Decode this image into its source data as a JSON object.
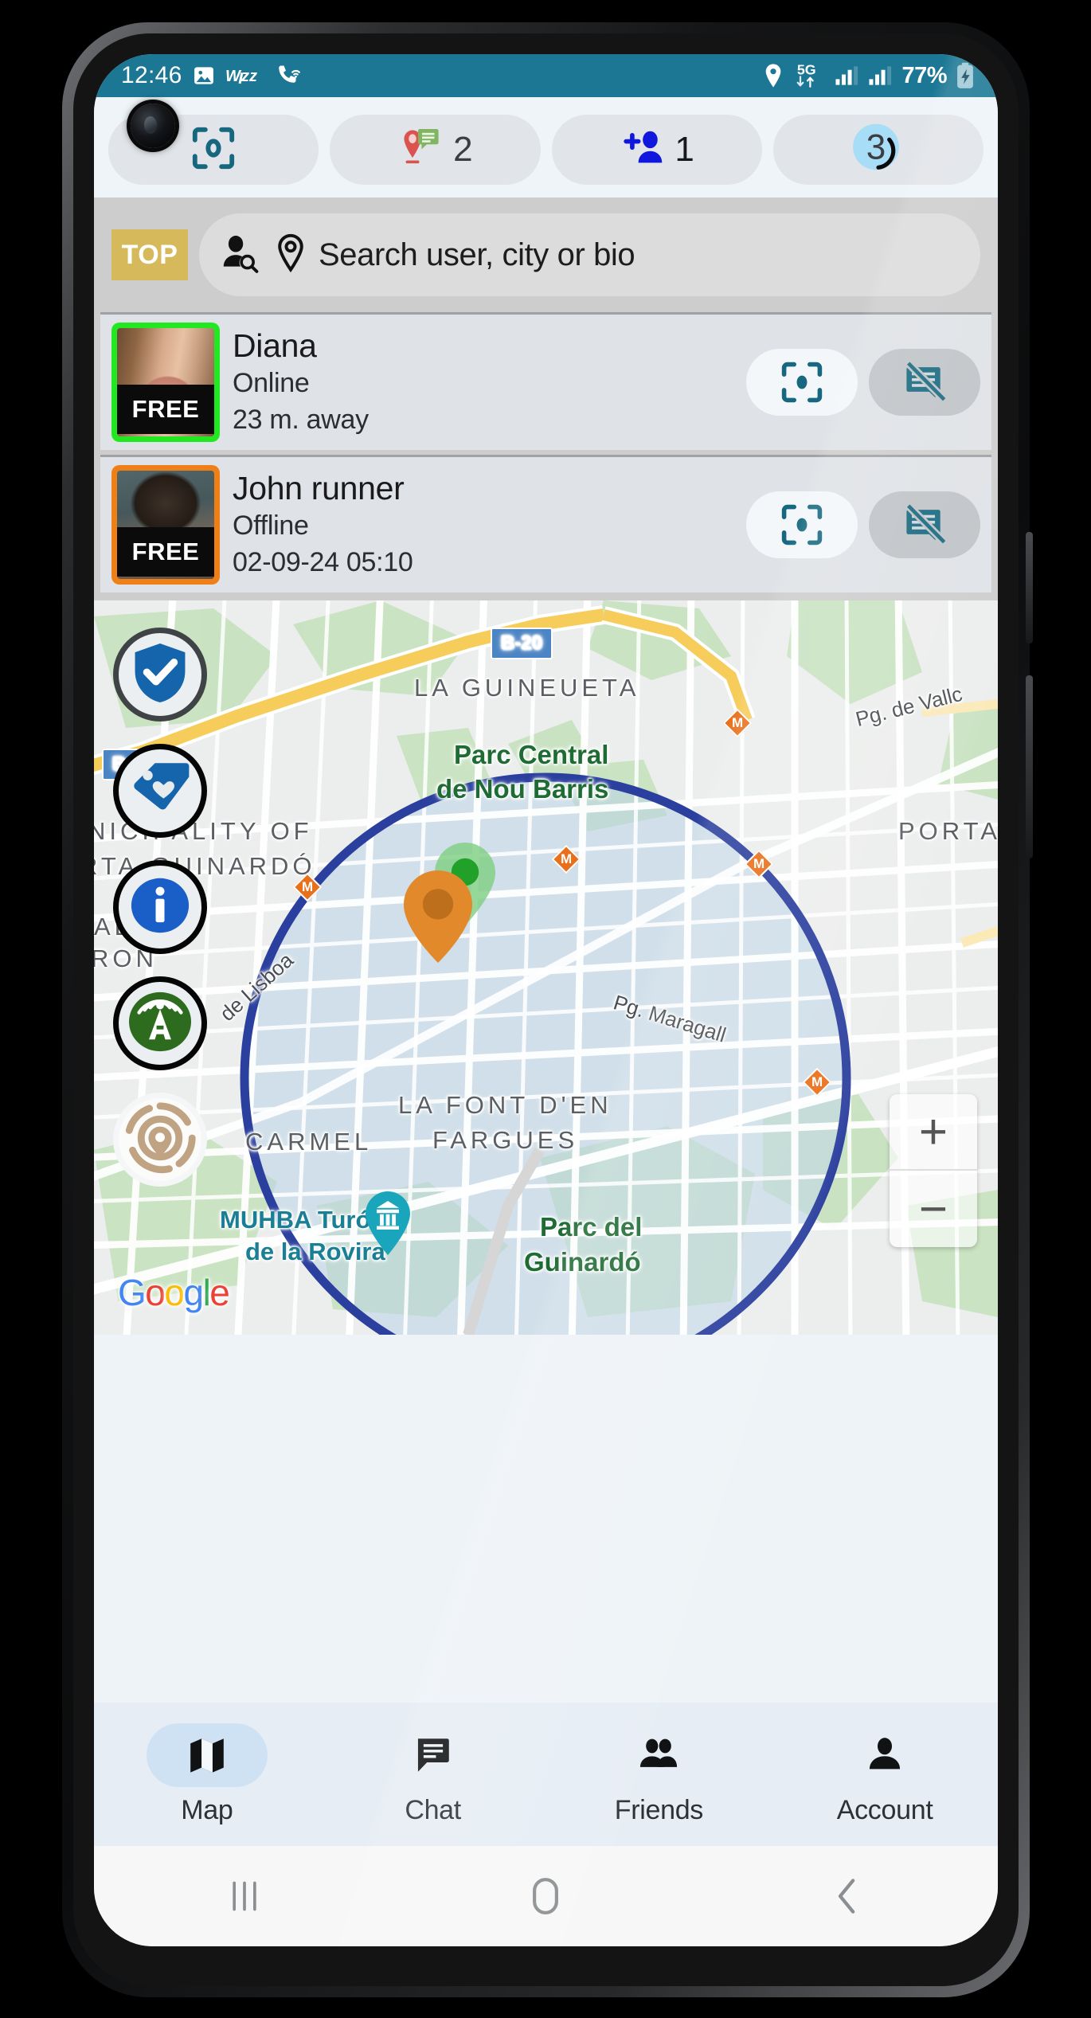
{
  "status_bar": {
    "time": "12:46",
    "battery_percent": "77%",
    "network_type": "5G",
    "left_icons": [
      "image-icon",
      "wizz-icon",
      "call-wifi-icon"
    ],
    "right_icons": [
      "location-pin-icon",
      "5g-data-icon",
      "signal-bars-1-icon",
      "signal-bars-2-icon",
      "battery-charging-icon"
    ],
    "background_color": "#1b7794"
  },
  "chips": [
    {
      "name": "focus-scan-chip",
      "icon": "focus-scan-icon",
      "count": ""
    },
    {
      "name": "messages-chip",
      "icon": "pin-message-icon",
      "count": "2"
    },
    {
      "name": "friend-requests-chip",
      "icon": "add-person-icon",
      "count": "1"
    },
    {
      "name": "pending-chip",
      "icon": "circle-count-icon",
      "count": "3"
    }
  ],
  "search": {
    "badge": "TOP",
    "placeholder": "Search user, city or bio",
    "badge_color": "#d5b95a"
  },
  "users": [
    {
      "name": "Diana",
      "status": "Online",
      "sub": "23 m. away",
      "badge": "FREE",
      "border_color": "#22e822",
      "actions": [
        "locate-button",
        "chat-disabled-button"
      ]
    },
    {
      "name": "John runner",
      "status": "Offline",
      "sub": "02-09-24 05:10",
      "badge": "FREE",
      "border_color": "#ef8018",
      "actions": [
        "locate-button",
        "chat-disabled-button"
      ]
    }
  ],
  "map_fabs": [
    {
      "name": "verified-shield-fab",
      "icon": "shield-check-icon",
      "color": "#1565ad"
    },
    {
      "name": "favorites-fab",
      "icon": "tag-heart-icon",
      "color": "#1565ad"
    },
    {
      "name": "info-fab",
      "icon": "info-icon",
      "color": "#1a5fc8"
    },
    {
      "name": "broadcast-fab",
      "icon": "antenna-broadcast-icon",
      "color": "#2d6b1f"
    },
    {
      "name": "radar-locate-fab",
      "icon": "radar-target-icon",
      "color": "#c0a383"
    }
  ],
  "map": {
    "attribution": "Google",
    "zoom_in": "+",
    "zoom_out": "−",
    "labels": [
      {
        "text": "B-20",
        "type": "shield"
      },
      {
        "text": "B-20",
        "type": "shield"
      },
      {
        "text": "LA GUINEUETA",
        "type": "district"
      },
      {
        "text": "Pg. de Vallc",
        "type": "road"
      },
      {
        "text": "Parc Central",
        "type": "park"
      },
      {
        "text": "de Nou Barris",
        "type": "park"
      },
      {
        "text": "PORTA",
        "type": "district"
      },
      {
        "text": "NICIPALITY OF",
        "type": "district"
      },
      {
        "text": "RTA-GUINARDÓ",
        "type": "district"
      },
      {
        "text": "AL",
        "type": "district"
      },
      {
        "text": "RON",
        "type": "district"
      },
      {
        "text": "de Lisboa",
        "type": "road"
      },
      {
        "text": "Pg. Maragall",
        "type": "road"
      },
      {
        "text": "LA FONT D'EN",
        "type": "district"
      },
      {
        "text": "FARGUES",
        "type": "district"
      },
      {
        "text": "CARMEL",
        "type": "district"
      },
      {
        "text": "MUHBA Turó",
        "type": "poi"
      },
      {
        "text": "de la Rovira",
        "type": "poi"
      },
      {
        "text": "Parc del",
        "type": "park"
      },
      {
        "text": "Guinardó",
        "type": "park"
      }
    ],
    "radius_circle_color": "#2b3f9e",
    "pins": [
      {
        "name": "green-user-pin",
        "color": "#2fb53a"
      },
      {
        "name": "orange-user-pin",
        "color": "#e2892b"
      },
      {
        "name": "museum-pin",
        "color": "#19a6bd"
      }
    ]
  },
  "bottom_nav": [
    {
      "label": "Map",
      "icon": "map-icon",
      "active": true
    },
    {
      "label": "Chat",
      "icon": "chat-icon",
      "active": false
    },
    {
      "label": "Friends",
      "icon": "friends-icon",
      "active": false
    },
    {
      "label": "Account",
      "icon": "account-icon",
      "active": false
    }
  ],
  "android_nav": [
    {
      "name": "recents-button",
      "icon": "recents-icon"
    },
    {
      "name": "home-button",
      "icon": "home-icon"
    },
    {
      "name": "back-button",
      "icon": "back-icon"
    }
  ]
}
